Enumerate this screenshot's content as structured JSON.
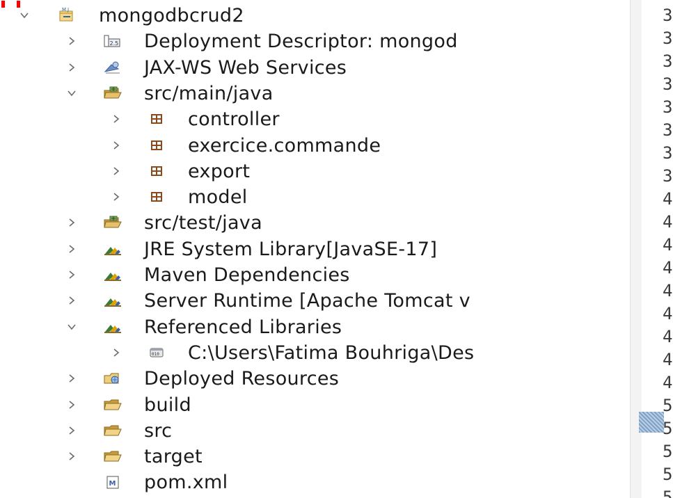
{
  "top_marker": {
    "text": "",
    "color": "#ff0000"
  },
  "tree": {
    "items": [
      {
        "label": "mongodbcrud2",
        "decoration": "",
        "icon": "maven-web-project-icon",
        "expanded": true,
        "depth": 0
      },
      {
        "label": "Deployment Descriptor: mongod",
        "decoration": "",
        "icon": "deployment-descriptor-icon",
        "expanded": false,
        "depth": 1
      },
      {
        "label": "JAX-WS Web Services",
        "decoration": "",
        "icon": "web-services-icon",
        "expanded": false,
        "depth": 1
      },
      {
        "label": "src/main/java",
        "decoration": "",
        "icon": "source-folder-icon",
        "expanded": true,
        "depth": 1
      },
      {
        "label": "controller",
        "decoration": "",
        "icon": "package-icon",
        "expanded": false,
        "depth": 2
      },
      {
        "label": "exercice.commande",
        "decoration": "",
        "icon": "package-icon",
        "expanded": false,
        "depth": 2
      },
      {
        "label": "export",
        "decoration": "",
        "icon": "package-icon",
        "expanded": false,
        "depth": 2
      },
      {
        "label": "model",
        "decoration": "",
        "icon": "package-icon",
        "expanded": false,
        "depth": 2
      },
      {
        "label": "src/test/java",
        "decoration": "",
        "icon": "source-folder-icon",
        "expanded": false,
        "depth": 1
      },
      {
        "label": "JRE System Library ",
        "decoration": "[JavaSE-17]",
        "icon": "library-icon",
        "expanded": false,
        "depth": 1
      },
      {
        "label": "Maven Dependencies",
        "decoration": "",
        "icon": "library-icon",
        "expanded": false,
        "depth": 1
      },
      {
        "label": "Server Runtime [Apache Tomcat v",
        "decoration": "",
        "icon": "library-icon",
        "expanded": false,
        "depth": 1
      },
      {
        "label": "Referenced Libraries",
        "decoration": "",
        "icon": "library-icon",
        "expanded": true,
        "depth": 1
      },
      {
        "label": "C:\\Users\\Fatima Bouhriga\\Des",
        "decoration": "",
        "icon": "jar-file-icon",
        "expanded": false,
        "depth": 2
      },
      {
        "label": "Deployed Resources",
        "decoration": "",
        "icon": "deployed-resources-icon",
        "expanded": false,
        "depth": 1
      },
      {
        "label": "build",
        "decoration": "",
        "icon": "folder-icon",
        "expanded": false,
        "depth": 1
      },
      {
        "label": "src",
        "decoration": "",
        "icon": "folder-icon",
        "expanded": false,
        "depth": 1
      },
      {
        "label": "target",
        "decoration": "",
        "icon": "folder-icon",
        "expanded": false,
        "depth": 1
      },
      {
        "label": "pom.xml",
        "decoration": "",
        "icon": "maven-pom-file-icon",
        "expanded": null,
        "depth": 1
      }
    ]
  },
  "line_numbers": [
    "3",
    "3",
    "3",
    "3",
    "3",
    "3",
    "3",
    "3",
    "4",
    "4",
    "4",
    "4",
    "4",
    "4",
    "4",
    "4",
    "4",
    "5",
    "5",
    "5",
    "5",
    "5"
  ],
  "colors": {
    "text": "#1a1a1a",
    "decoration": "#b39a5a",
    "chevron": "#6b6b6b",
    "package": "#8b4a1c",
    "folder": "#c89b3c",
    "library_a": "#e0a100",
    "library_b": "#3a7a3a",
    "library_c": "#3a5fa8"
  }
}
